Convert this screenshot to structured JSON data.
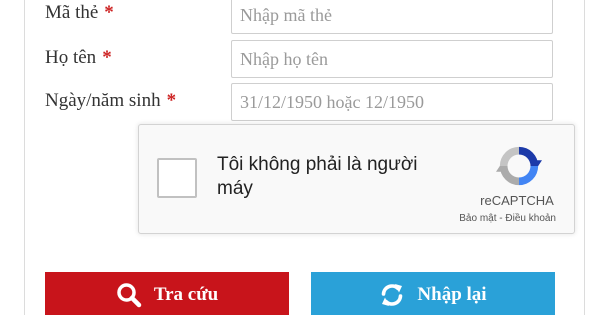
{
  "form": {
    "card_number": {
      "label": "Mã thẻ",
      "required_mark": "*",
      "placeholder": "Nhập mã thẻ"
    },
    "full_name": {
      "label": "Họ tên",
      "required_mark": "*",
      "placeholder": "Nhập họ tên"
    },
    "birth_date": {
      "label": "Ngày/năm sinh",
      "required_mark": "*",
      "placeholder": "31/12/1950 hoặc 12/1950"
    }
  },
  "recaptcha": {
    "checkbox_label": "Tôi không phải là người máy",
    "brand": "reCAPTCHA",
    "privacy_link": "Bảo mật",
    "separator": " - ",
    "terms_link": "Điều khoản",
    "logo_icon": "recaptcha-logo-icon"
  },
  "buttons": {
    "search": {
      "label": "Tra cứu",
      "icon": "search-icon",
      "color": "#c8141b"
    },
    "reset": {
      "label": "Nhập lại",
      "icon": "refresh-icon",
      "color": "#2aa1d8"
    }
  },
  "colors": {
    "required": "#cc1f1f",
    "label_text": "#333333",
    "placeholder": "#9a9a9a"
  }
}
